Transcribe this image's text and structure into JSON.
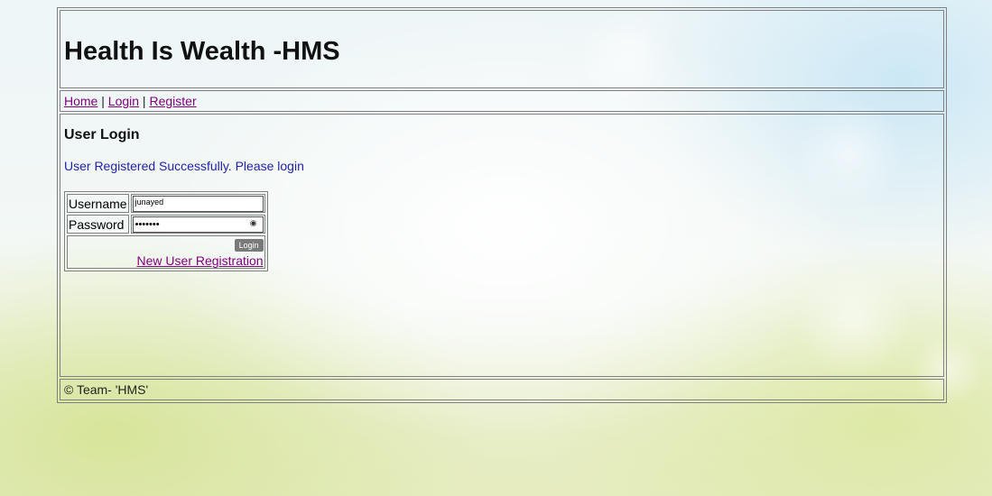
{
  "header": {
    "title": "Health Is Wealth -HMS"
  },
  "nav": {
    "home": "Home",
    "sep1": " | ",
    "login": "Login",
    "sep2": " | ",
    "register": "Register"
  },
  "login_section": {
    "heading": "User Login",
    "message": "User Registered Successfully. Please login",
    "username_label": "Username",
    "username_value": "junayed",
    "password_label": "Password",
    "password_value": "•••••••",
    "password_toggle_icon": "eye-icon",
    "login_button": "Login",
    "register_link": "New User Registration"
  },
  "footer": {
    "text": "© Team- 'HMS'"
  },
  "colors": {
    "link_visited": "#800080",
    "message": "#2222aa",
    "button": "#7a7a7a"
  }
}
